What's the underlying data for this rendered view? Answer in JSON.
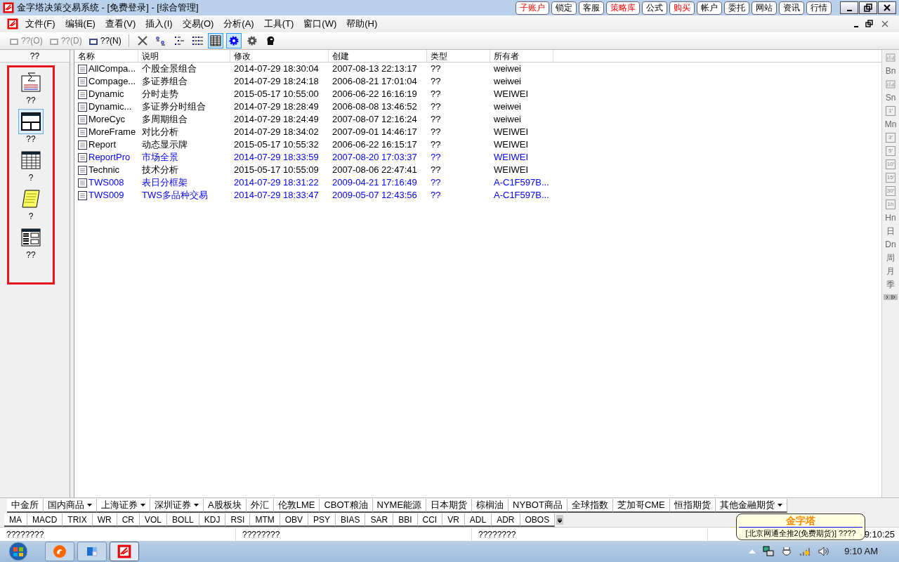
{
  "window": {
    "title": "金字塔决策交易系统 - [免费登录] - [综合管理]"
  },
  "title_buttons": [
    {
      "label": "子账户",
      "emphasized": true
    },
    {
      "label": "锁定",
      "emphasized": false
    },
    {
      "label": "客服",
      "emphasized": false
    },
    {
      "label": "策略库",
      "emphasized": true
    },
    {
      "label": "公式",
      "emphasized": false
    },
    {
      "label": "购买",
      "emphasized": true
    },
    {
      "label": "帐户",
      "emphasized": false
    },
    {
      "label": "委托",
      "emphasized": false
    },
    {
      "label": "网站",
      "emphasized": false
    },
    {
      "label": "资讯",
      "emphasized": false
    },
    {
      "label": "行情",
      "emphasized": false
    }
  ],
  "menu": [
    "文件(F)",
    "编辑(E)",
    "查看(V)",
    "插入(I)",
    "交易(O)",
    "分析(A)",
    "工具(T)",
    "窗口(W)",
    "帮助(H)"
  ],
  "toolbar": {
    "text_buttons": [
      {
        "label": "??(O)",
        "disabled": true
      },
      {
        "label": "??(D)",
        "disabled": true
      },
      {
        "label": "??(N)",
        "disabled": false
      }
    ],
    "icon_buttons": [
      {
        "kind": "delete",
        "selected": false
      },
      {
        "kind": "large",
        "selected": false
      },
      {
        "kind": "tree",
        "selected": false
      },
      {
        "kind": "list",
        "selected": false
      },
      {
        "kind": "details",
        "selected": true
      },
      {
        "kind": "gear",
        "selected": true
      },
      {
        "kind": "cog",
        "selected": false
      },
      {
        "kind": "head",
        "selected": false
      }
    ]
  },
  "sidebar": {
    "title": "??",
    "items": [
      {
        "kind": "formula",
        "label": "??",
        "selected": false
      },
      {
        "kind": "layout",
        "label": "??",
        "selected": true
      },
      {
        "kind": "table",
        "label": "?",
        "selected": false
      },
      {
        "kind": "scroll",
        "label": "?",
        "selected": false
      },
      {
        "kind": "panel",
        "label": "??",
        "selected": false
      }
    ]
  },
  "table": {
    "columns": [
      "名称",
      "说明",
      "修改",
      "创建",
      "类型",
      "所有者"
    ],
    "rows": [
      {
        "cells": [
          "AllCompa...",
          "个股全景组合",
          "2014-07-29 18:30:04",
          "2007-08-13 22:13:17",
          "??",
          "weiwei"
        ],
        "color": "#000000"
      },
      {
        "cells": [
          "Compage...",
          "多证券组合",
          "2014-07-29 18:24:18",
          "2006-08-21 17:01:04",
          "??",
          "weiwei"
        ],
        "color": "#000000"
      },
      {
        "cells": [
          "Dynamic",
          "分时走势",
          "2015-05-17 10:55:00",
          "2006-06-22 16:16:19",
          "??",
          "WEIWEI"
        ],
        "color": "#000000"
      },
      {
        "cells": [
          "Dynamic...",
          "多证券分时组合",
          "2014-07-29 18:28:49",
          "2006-08-08 13:46:52",
          "??",
          "weiwei"
        ],
        "color": "#000000"
      },
      {
        "cells": [
          "MoreCyc",
          "多周期组合",
          "2014-07-29 18:24:49",
          "2007-08-07 12:16:24",
          "??",
          "weiwei"
        ],
        "color": "#000000"
      },
      {
        "cells": [
          "MoreFrame",
          "对比分析",
          "2014-07-29 18:34:02",
          "2007-09-01 14:46:17",
          "??",
          "WEIWEI"
        ],
        "color": "#000000"
      },
      {
        "cells": [
          "Report",
          "动态显示牌",
          "2015-05-17 10:55:32",
          "2006-06-22 16:15:17",
          "??",
          "WEIWEI"
        ],
        "color": "#000000"
      },
      {
        "cells": [
          "ReportPro",
          "市场全景",
          "2014-07-29 18:33:59",
          "2007-08-20 17:03:37",
          "??",
          "WEIWEI"
        ],
        "color": "#0000ff"
      },
      {
        "cells": [
          "Technic",
          "技术分析",
          "2015-05-17 10:55:09",
          "2007-08-06 22:47:41",
          "??",
          "WEIWEI"
        ],
        "color": "#000000"
      },
      {
        "cells": [
          "TWS008",
          "表日分框架",
          "2014-07-29 18:31:22",
          "2009-04-21 17:16:49",
          "??",
          "A-C1F597B..."
        ],
        "color": "#0000ff"
      },
      {
        "cells": [
          "TWS009",
          "TWS多品种交易",
          "2014-07-29 18:33:47",
          "2009-05-07 12:43:56",
          "??",
          "A-C1F597B..."
        ],
        "color": "#0000ff"
      }
    ]
  },
  "period_bar": [
    {
      "kind": "icon"
    },
    {
      "kind": "text",
      "label": "Bn"
    },
    {
      "kind": "icon"
    },
    {
      "kind": "text",
      "label": "Sn"
    },
    {
      "kind": "boxed",
      "label": "1′"
    },
    {
      "kind": "text",
      "label": "Mn"
    },
    {
      "kind": "boxed",
      "label": "3′"
    },
    {
      "kind": "boxed",
      "label": "5′"
    },
    {
      "kind": "boxed",
      "label": "10′"
    },
    {
      "kind": "boxed",
      "label": "15′"
    },
    {
      "kind": "boxed",
      "label": "30′"
    },
    {
      "kind": "boxed",
      "label": "1h"
    },
    {
      "kind": "text",
      "label": "Hn"
    },
    {
      "kind": "text",
      "label": "日"
    },
    {
      "kind": "text",
      "label": "Dn"
    },
    {
      "kind": "text",
      "label": "周"
    },
    {
      "kind": "text",
      "label": "月"
    },
    {
      "kind": "text",
      "label": "季"
    }
  ],
  "market_tabs": [
    {
      "label": "中金所",
      "dropdown": false
    },
    {
      "label": "国内商品",
      "dropdown": true
    },
    {
      "label": "上海证券",
      "dropdown": true
    },
    {
      "label": "深圳证券",
      "dropdown": true
    },
    {
      "label": "A股板块",
      "dropdown": false
    },
    {
      "label": "外汇",
      "dropdown": false
    },
    {
      "label": "伦敦LME",
      "dropdown": false
    },
    {
      "label": "CBOT粮油",
      "dropdown": false
    },
    {
      "label": "NYME能源",
      "dropdown": false
    },
    {
      "label": "日本期货",
      "dropdown": false
    },
    {
      "label": "棕榈油",
      "dropdown": false
    },
    {
      "label": "NYBOT商品",
      "dropdown": false
    },
    {
      "label": "全球指数",
      "dropdown": false
    },
    {
      "label": "芝加哥CME",
      "dropdown": false
    },
    {
      "label": "恒指期货",
      "dropdown": false
    },
    {
      "label": "其他金融期货",
      "dropdown": true
    }
  ],
  "indicator_tabs": [
    "MA",
    "MACD",
    "TRIX",
    "WR",
    "CR",
    "VOL",
    "BOLL",
    "KDJ",
    "RSI",
    "MTM",
    "OBV",
    "PSY",
    "BIAS",
    "SAR",
    "BBI",
    "CCI",
    "VR",
    "ADL",
    "ADR",
    "OBOS"
  ],
  "status_bar": {
    "segments": [
      "????????",
      "????????",
      "????????"
    ],
    "time": "9:10:25"
  },
  "tooltip": {
    "title": "金字塔",
    "text": "[北京网通全推2(免费期货)] ????"
  },
  "taskbar": {
    "apps": [
      {
        "kind": "browser",
        "selected": false
      },
      {
        "kind": "app",
        "selected": false
      },
      {
        "kind": "trading",
        "selected": true
      }
    ],
    "clock": "9:10 AM"
  }
}
